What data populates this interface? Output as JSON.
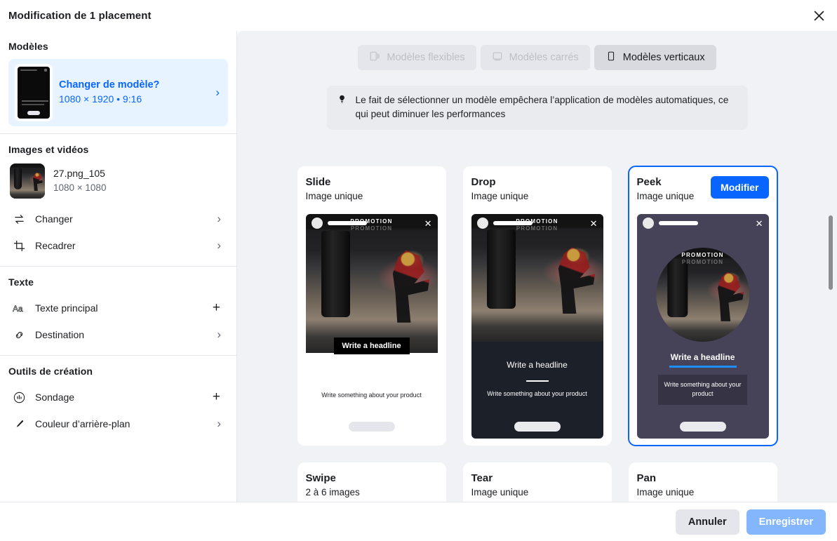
{
  "header": {
    "title": "Modification de 1 placement",
    "close_icon": "close-icon"
  },
  "sidebar": {
    "sections": [
      {
        "title": "Modèles",
        "model_card": {
          "question": "Changer de modèle?",
          "dimensions": "1080 × 1920 • 9:16",
          "chevron": "›"
        }
      },
      {
        "title": "Images et vidéos",
        "media": {
          "name": "27.png_105",
          "dimensions": "1080 × 1080"
        },
        "rows": [
          {
            "label": "Changer",
            "icon": "swap-arrows-icon",
            "action": "›"
          },
          {
            "label": "Recadrer",
            "icon": "crop-icon",
            "action": "›"
          }
        ]
      },
      {
        "title": "Texte",
        "rows": [
          {
            "label": "Texte principal",
            "icon": "text-format-icon",
            "action": "+"
          },
          {
            "label": "Destination",
            "icon": "link-icon",
            "action": "›"
          }
        ]
      },
      {
        "title": "Outils de création",
        "rows": [
          {
            "label": "Sondage",
            "icon": "poll-chart-icon",
            "action": "+"
          },
          {
            "label": "Couleur d’arrière-plan",
            "icon": "eyedropper-icon",
            "action": "›"
          }
        ]
      }
    ]
  },
  "main": {
    "tabs": [
      {
        "label": "Modèles flexibles",
        "icon": "flexible-template-icon",
        "active": false
      },
      {
        "label": "Modèles carrés",
        "icon": "square-template-icon",
        "active": false
      },
      {
        "label": "Modèles verticaux",
        "icon": "vertical-template-icon",
        "active": true
      }
    ],
    "notice": {
      "icon": "lightbulb-icon",
      "text": "Le fait de sélectionner un modèle empêchera l’application de modèles automatiques, ce qui peut diminuer les performances"
    },
    "preview_strings": {
      "promotion": "PROMOTION",
      "headline": "Write a headline",
      "body": "Write something about your product",
      "close": "✕"
    },
    "cards": [
      {
        "title": "Slide",
        "subtitle": "Image unique",
        "selected": false,
        "layout": "slide"
      },
      {
        "title": "Drop",
        "subtitle": "Image unique",
        "selected": false,
        "layout": "drop"
      },
      {
        "title": "Peek",
        "subtitle": "Image unique",
        "selected": true,
        "layout": "peek",
        "edit_label": "Modifier"
      },
      {
        "title": "Swipe",
        "subtitle": "2 à 6 images",
        "selected": false,
        "layout": "swipe"
      },
      {
        "title": "Tear",
        "subtitle": "Image unique",
        "selected": false,
        "layout": "plain"
      },
      {
        "title": "Pan",
        "subtitle": "Image unique",
        "selected": false,
        "layout": "plain"
      }
    ]
  },
  "footer": {
    "cancel_label": "Annuler",
    "save_label": "Enregistrer"
  },
  "colors": {
    "accent": "#0866ff",
    "accent_soft": "#e7f3ff",
    "panel_bg": "#f0f2f5",
    "save_disabled": "#83b6fc",
    "peek_bg": "#464258",
    "drop_bg": "#1c2029"
  }
}
